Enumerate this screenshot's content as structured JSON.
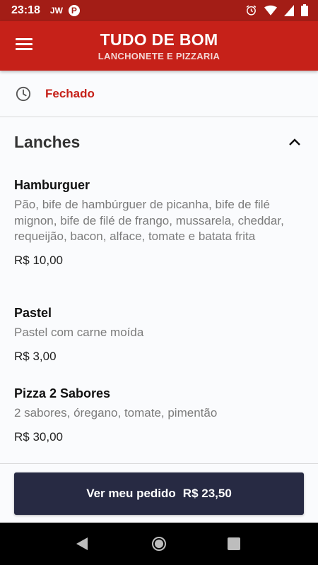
{
  "status_bar": {
    "time": "23:18",
    "carrier": "JW",
    "app_badge": "P"
  },
  "header": {
    "title": "TUDO DE BOM",
    "subtitle": "LANCHONETE E PIZZARIA"
  },
  "store_status": {
    "label": "Fechado",
    "color": "#c62119"
  },
  "section": {
    "title": "Lanches",
    "expanded": true
  },
  "items": [
    {
      "name": "Hamburguer",
      "description": "Pão, bife de hambúrguer de picanha, bife de filé mignon, bife de filé de frango, mussarela, cheddar, requeijão, bacon, alface, tomate e batata frita",
      "price": "R$ 10,00"
    },
    {
      "name": "Pastel",
      "description": "Pastel com carne moída",
      "price": "R$ 3,00"
    },
    {
      "name": "Pizza 2 Sabores",
      "description": "2 sabores, óregano, tomate, pimentão",
      "price": "R$ 30,00"
    }
  ],
  "order_button": {
    "label": "Ver meu pedido",
    "total": "R$ 23,50"
  },
  "colors": {
    "status_bar": "#a31d16",
    "app_bar": "#c62119",
    "button": "#272a43"
  },
  "icons": [
    "menu-icon",
    "clock-icon",
    "chevron-up-icon",
    "alarm-icon",
    "wifi-icon",
    "signal-icon",
    "battery-icon",
    "back-icon",
    "home-icon",
    "recents-icon"
  ]
}
